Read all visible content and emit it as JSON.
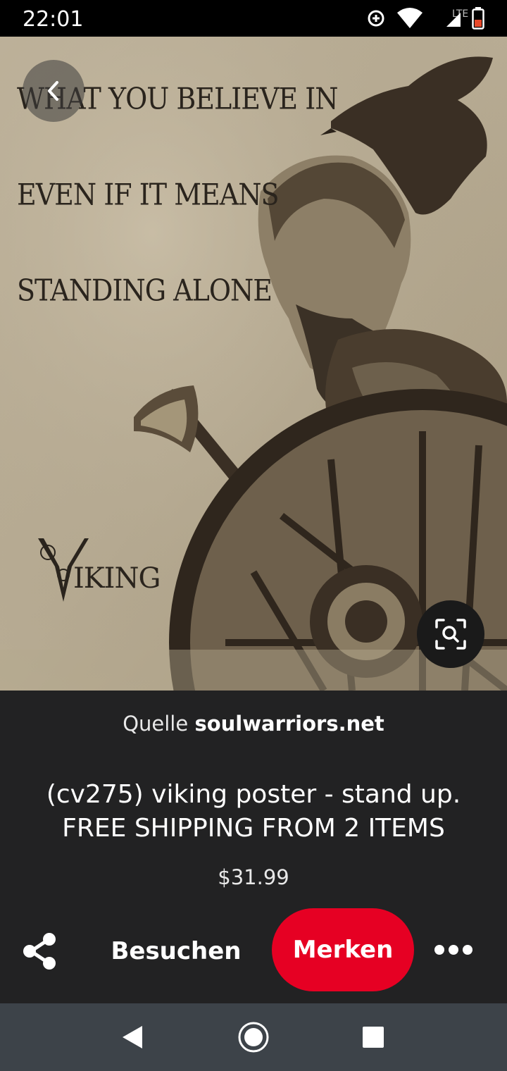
{
  "status_bar": {
    "time": "22:01",
    "network_label": "LTE",
    "icons": [
      "data-saver-icon",
      "wifi-icon",
      "cell-signal-icon",
      "battery-low-icon"
    ]
  },
  "hero": {
    "quote_lines": [
      "WHAT YOU BELIEVE IN",
      "EVEN IF IT MEANS",
      "STANDING ALONE"
    ],
    "brand_text": "IKING",
    "colors": {
      "parchment": "#bcb098",
      "ink": "#2a241d"
    }
  },
  "pin": {
    "source_prefix": "Quelle",
    "source_domain": "soulwarriors.net",
    "title": "(cv275) viking poster - stand up. FREE SHIPPING FROM 2 ITEMS",
    "price": "$31.99"
  },
  "actions": {
    "visit_label": "Besuchen",
    "save_label": "Merken",
    "save_color": "#e60023"
  },
  "nav": {
    "icons": [
      "nav-back-icon",
      "nav-home-icon",
      "nav-recents-icon"
    ]
  }
}
